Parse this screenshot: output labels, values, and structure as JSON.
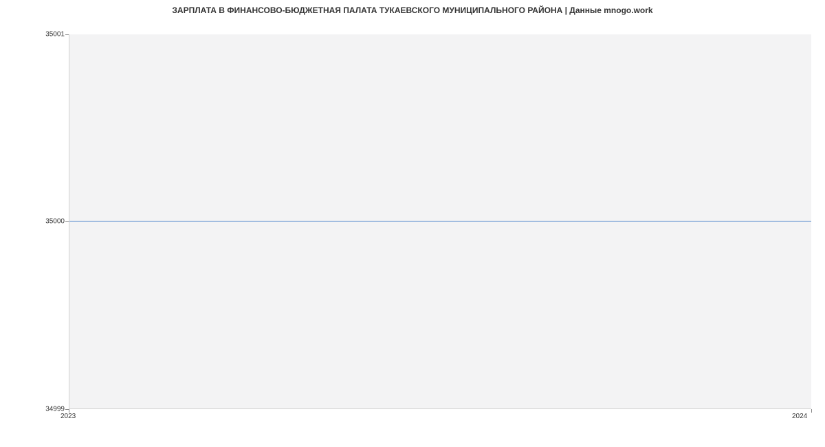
{
  "chart_data": {
    "type": "line",
    "title": "ЗАРПЛАТА В ФИНАНСОВО-БЮДЖЕТНАЯ ПАЛАТА ТУКАЕВСКОГО МУНИЦИПАЛЬНОГО РАЙОНА | Данные mnogo.work",
    "x": [
      2023,
      2024
    ],
    "values": [
      35000,
      35000
    ],
    "xlabel": "",
    "ylabel": "",
    "xlim": [
      2023,
      2024
    ],
    "ylim": [
      34999,
      35001
    ],
    "x_ticks": [
      "2023",
      "2024"
    ],
    "y_ticks": [
      "34999",
      "35000",
      "35001"
    ]
  }
}
